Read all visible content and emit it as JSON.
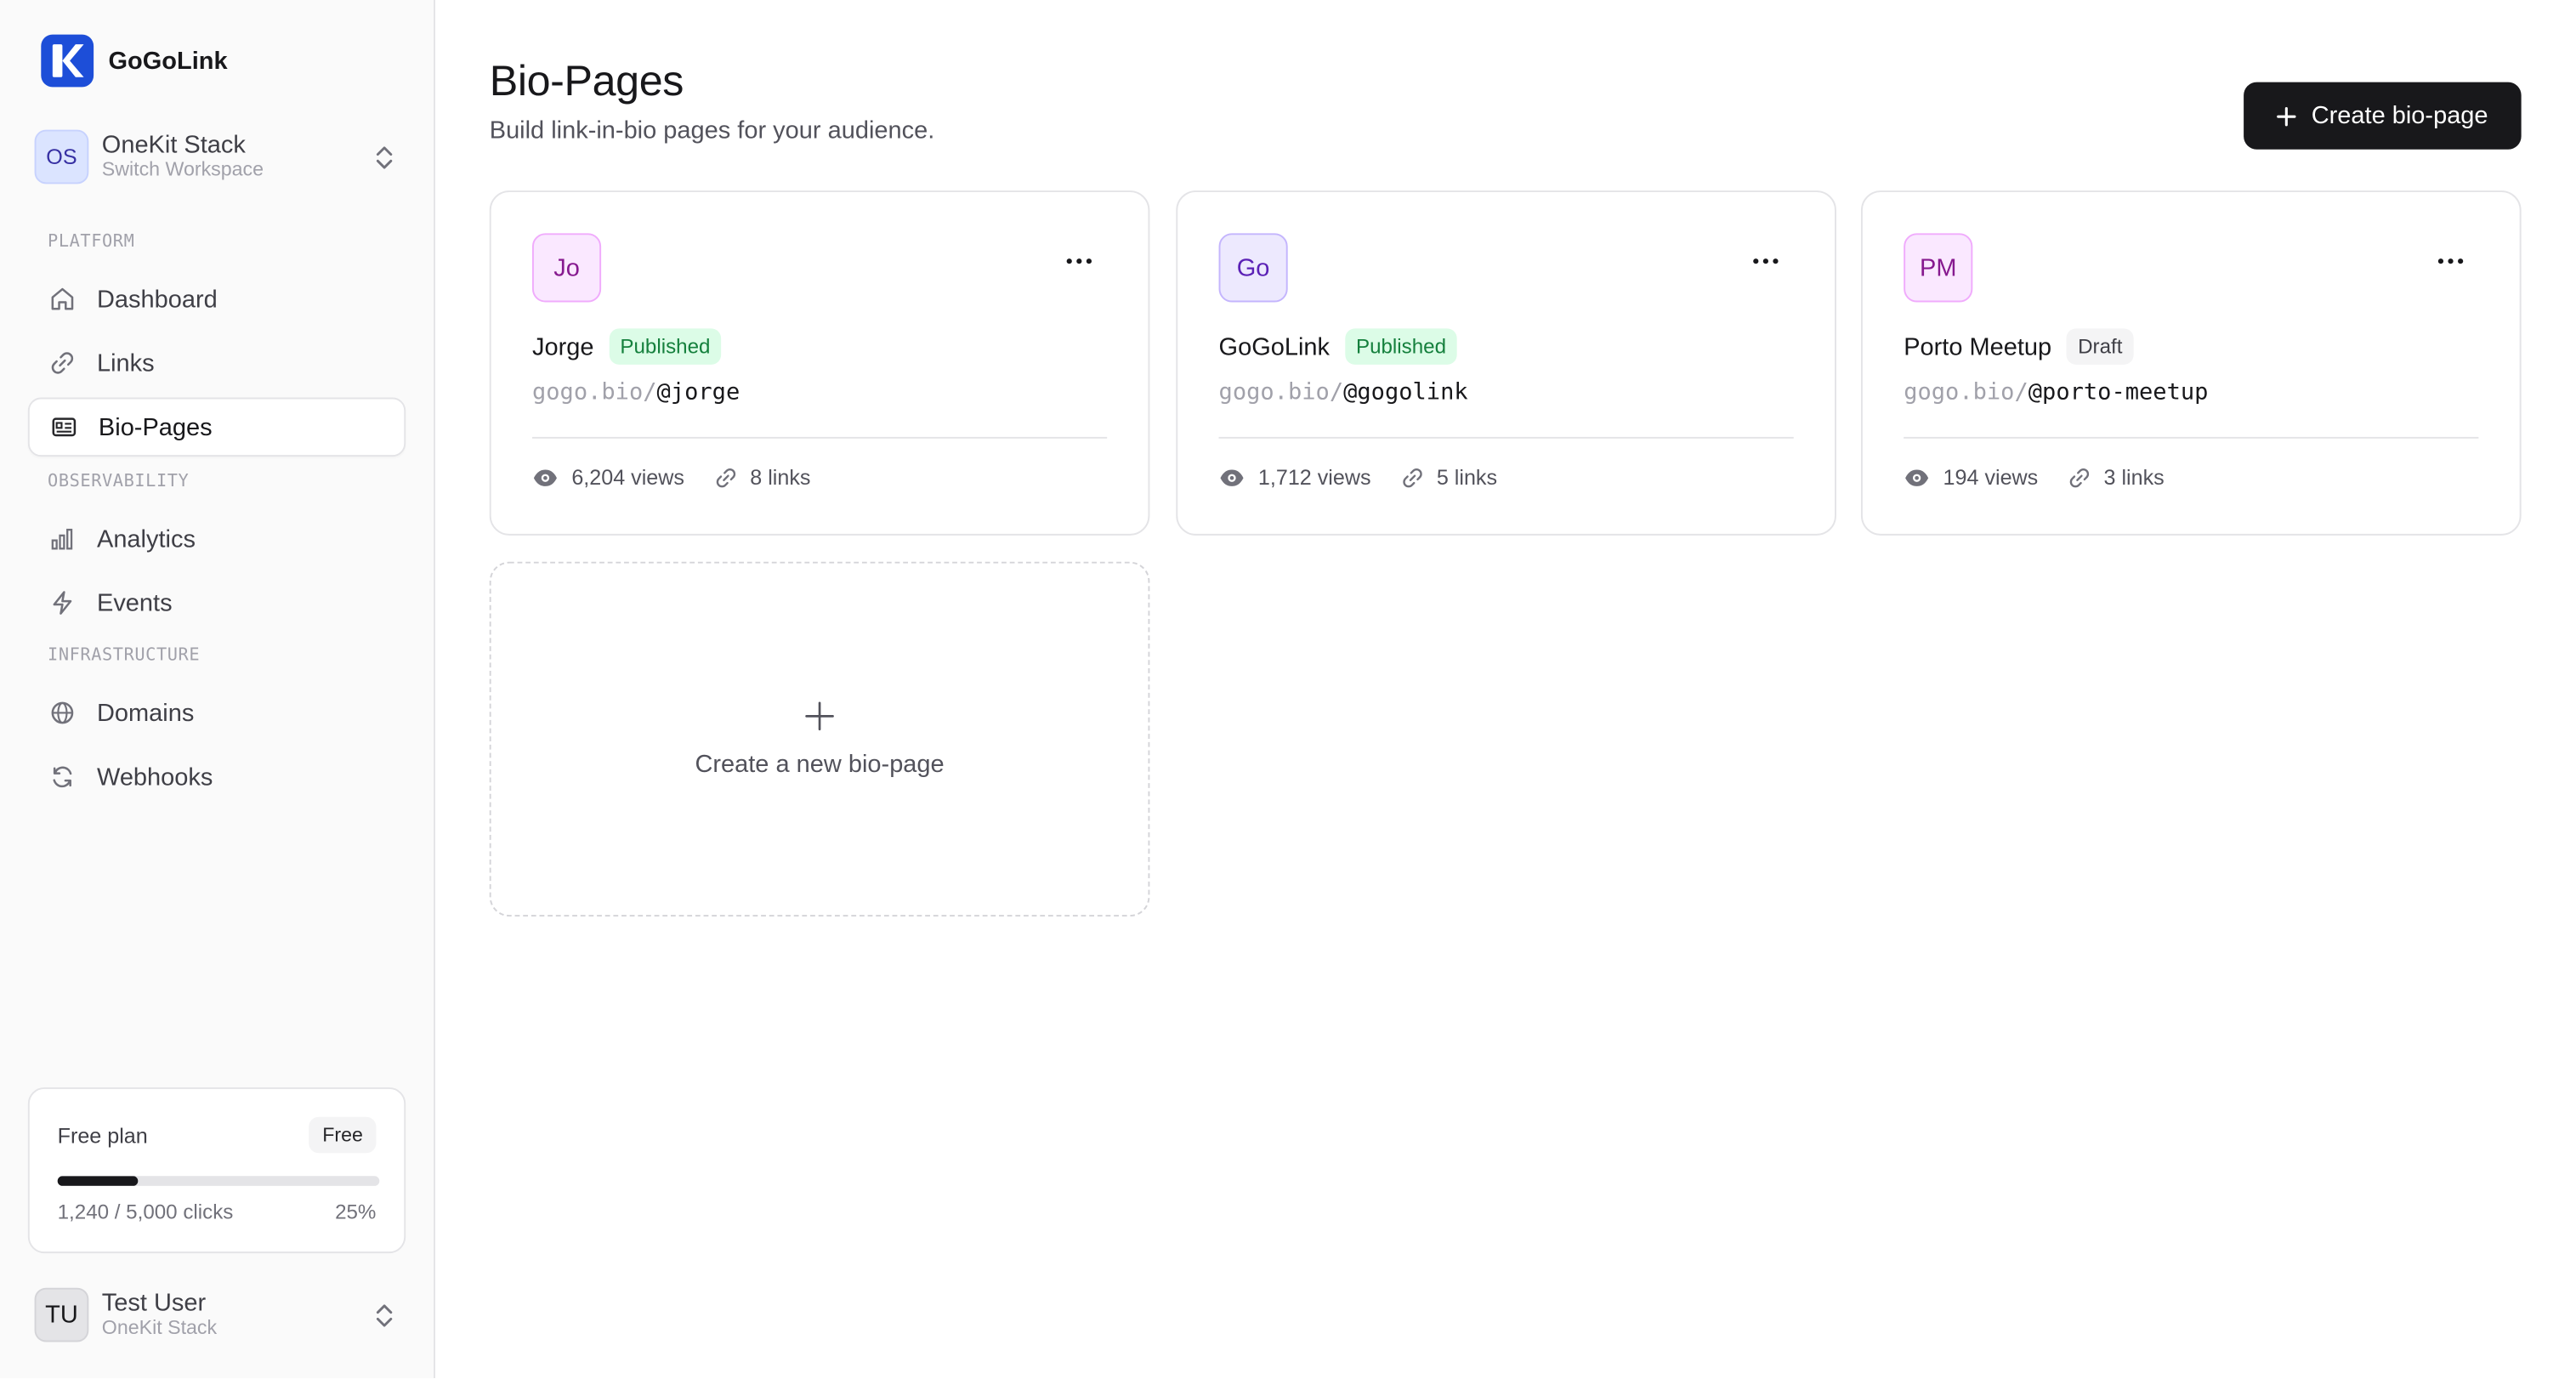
{
  "sidebar": {
    "brand": {
      "name": "GoGoLink",
      "logo_color": "#1d4ed8",
      "logo_letter": "K"
    },
    "workspace": {
      "initials": "OS",
      "name": "OneKit Stack",
      "subtitle": "Switch Workspace"
    },
    "sections": {
      "platform": "PLATFORM",
      "observability": "OBSERVABILITY",
      "infrastructure": "INFRASTRUCTURE"
    },
    "nav": {
      "dashboard": "Dashboard",
      "links": "Links",
      "bio_pages": "Bio-Pages",
      "analytics": "Analytics",
      "events": "Events",
      "domains": "Domains",
      "webhooks": "Webhooks"
    },
    "active_item": "bio_pages",
    "plan": {
      "title": "Free plan",
      "badge": "Free",
      "usage_text": "1,240 / 5,000 clicks",
      "percent_text": "25%",
      "progress_fraction": 0.25
    },
    "user": {
      "initials": "TU",
      "name": "Test User",
      "org": "OneKit Stack"
    }
  },
  "header": {
    "title": "Bio-Pages",
    "subtitle": "Build link-in-bio pages for your audience.",
    "create_label": "Create bio-page"
  },
  "cards": [
    {
      "initials": "Jo",
      "avatar_bg": "#fae8ff",
      "avatar_border": "#f0abfc",
      "avatar_fg": "#86198f",
      "name": "Jorge",
      "status": "Published",
      "status_kind": "published",
      "url_prefix": "gogo.bio/",
      "handle": "@jorge",
      "views": "6,204 views",
      "links": "8 links"
    },
    {
      "initials": "Go",
      "avatar_bg": "#ede9fe",
      "avatar_border": "#c4b5fd",
      "avatar_fg": "#5b21b6",
      "name": "GoGoLink",
      "status": "Published",
      "status_kind": "published",
      "url_prefix": "gogo.bio/",
      "handle": "@gogolink",
      "views": "1,712 views",
      "links": "5 links"
    },
    {
      "initials": "PM",
      "avatar_bg": "#fae8ff",
      "avatar_border": "#f0abfc",
      "avatar_fg": "#86198f",
      "name": "Porto Meetup",
      "status": "Draft",
      "status_kind": "draft",
      "url_prefix": "gogo.bio/",
      "handle": "@porto-meetup",
      "views": "194 views",
      "links": "3 links"
    }
  ],
  "new_card": {
    "label": "Create a new bio-page"
  },
  "icons": {
    "dashboard": "home-icon",
    "links": "link-icon",
    "bio_pages": "id-card-icon",
    "analytics": "bar-chart-icon",
    "events": "zap-icon",
    "domains": "globe-icon",
    "webhooks": "refresh-icon"
  }
}
